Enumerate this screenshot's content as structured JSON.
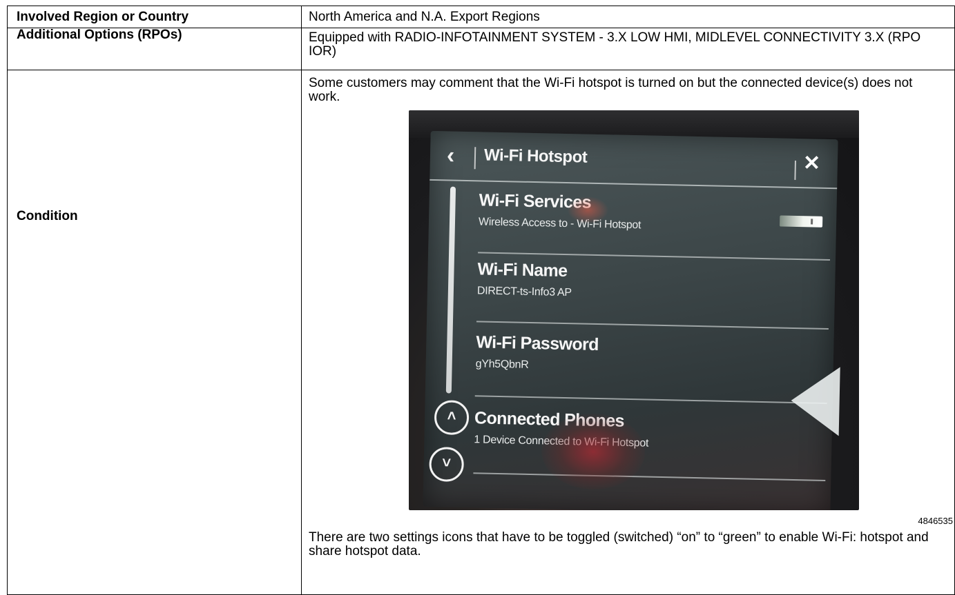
{
  "rows": {
    "region": {
      "label": "Involved Region or Country",
      "value": "North America and N.A. Export Regions"
    },
    "options": {
      "label": "Additional Options (RPOs)",
      "value": "Equipped with RADIO-INFOTAINMENT SYSTEM - 3.X LOW HMI, MIDLEVEL CONNECTIVITY 3.X (RPO IOR)"
    },
    "condition": {
      "label": "Condition",
      "text_1": "Some customers may comment that the Wi-Fi hotspot is turned on but the connected device(s) does not work.",
      "figure_id": "4846535",
      "text_2": "There are two settings icons that have to be toggled (switched) “on” to “green” to enable Wi-Fi: hotspot and share hotspot data."
    }
  },
  "photo": {
    "header_title": "Wi-Fi Hotspot",
    "back_icon": "chevron-left-icon",
    "close_icon": "close-icon",
    "items": [
      {
        "title": "Wi-Fi Services",
        "subtitle": "Wireless Access to - Wi-Fi Hotspot",
        "toggle_on": 1
      },
      {
        "title": "Wi-Fi Name",
        "subtitle": "DIRECT-ts-Info3 AP"
      },
      {
        "title": "Wi-Fi Password",
        "subtitle": "gYh5QbnR"
      },
      {
        "title": "Connected Phones",
        "subtitle": "1 Device Connected to Wi-Fi Hotspot"
      }
    ],
    "scroll_up_icon": "chevron-up-icon",
    "scroll_down_icon": "chevron-down-icon",
    "glyphs": {
      "back": "‹",
      "close": "✕",
      "up": "˄",
      "down": "˅"
    }
  },
  "colors": {
    "border": "#000000",
    "screen": "#3c4648"
  }
}
